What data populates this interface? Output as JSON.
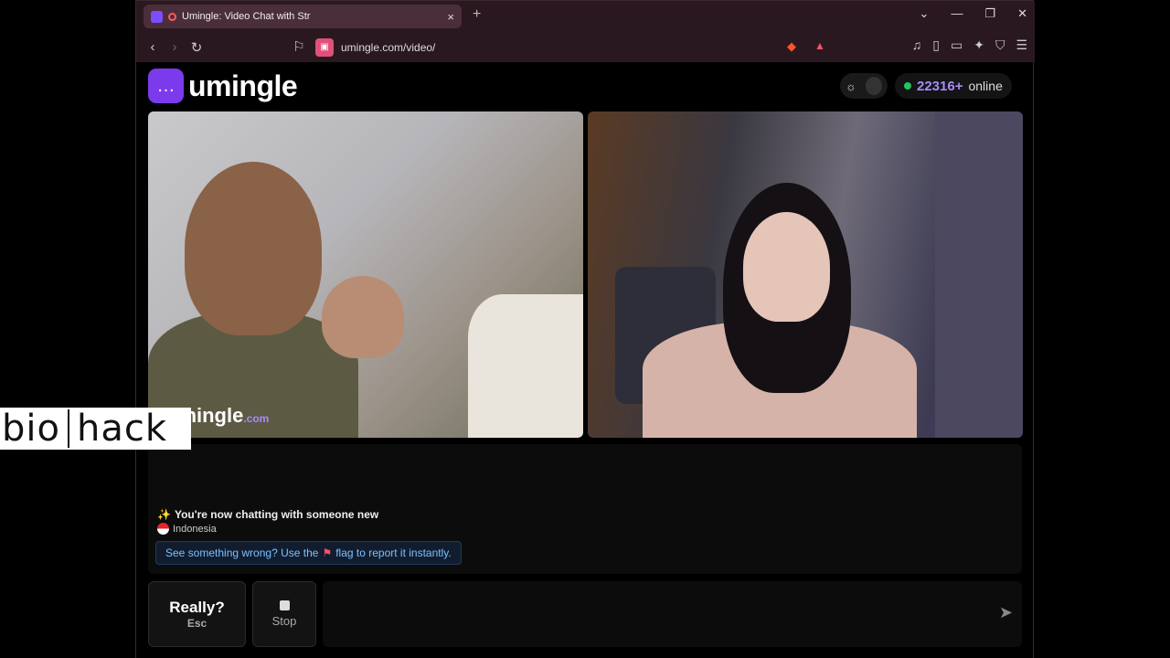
{
  "browser": {
    "tab_title": "Umingle: Video Chat with Str",
    "tab_close": "×",
    "new_tab": "+",
    "url": "umingle.com/video/",
    "window_controls": [
      "⌄",
      "—",
      "❐",
      "✕"
    ]
  },
  "site": {
    "logo_text": "umingle",
    "online_count": "22316+",
    "online_label": "online",
    "watermark_main": "umingle",
    "watermark_suffix": ".com"
  },
  "chat": {
    "system_message": "You're now chatting with someone new",
    "country": "Indonesia",
    "report_prefix": "See something wrong? Use the",
    "report_suffix": "flag to report it instantly."
  },
  "controls": {
    "next_label": "Really?",
    "next_shortcut": "Esc",
    "stop_label": "Stop",
    "message_placeholder": ""
  },
  "overlay": {
    "left": "bio",
    "right": "hack"
  },
  "colors": {
    "accent": "#7c3aed",
    "online_dot": "#22c55e",
    "report_text": "#7cc0ff"
  }
}
